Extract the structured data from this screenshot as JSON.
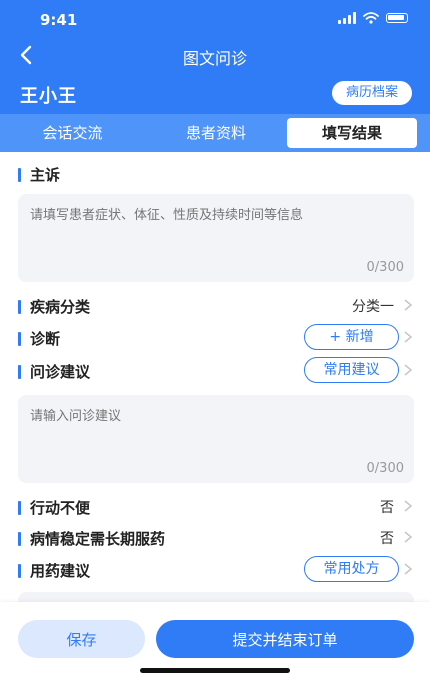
{
  "status": {
    "time": "9:41"
  },
  "nav": {
    "title": "图文问诊"
  },
  "patient": {
    "name": "王小王",
    "records_label": "病历档案"
  },
  "tabs": [
    {
      "label": "会话交流"
    },
    {
      "label": "患者资料"
    },
    {
      "label": "填写结果",
      "active": true
    }
  ],
  "form": {
    "complaint": {
      "title": "主诉",
      "placeholder": "请填写患者症状、体征、性质及持续时间等信息",
      "counter": "0/300"
    },
    "disease_category": {
      "title": "疾病分类",
      "value": "分类一"
    },
    "diagnosis": {
      "title": "诊断",
      "button": "+ 新增"
    },
    "advice": {
      "title": "问诊建议",
      "button": "常用建议",
      "placeholder": "请输入问诊建议",
      "counter": "0/300"
    },
    "mobility": {
      "title": "行动不便",
      "value": "否"
    },
    "long_term": {
      "title": "病情稳定需长期服药",
      "value": "否"
    },
    "medication": {
      "title": "用药建议",
      "button": "常用处方"
    }
  },
  "footer": {
    "save_label": "保存",
    "submit_label": "提交并结束订单"
  },
  "colors": {
    "primary": "#2f7cf6",
    "tab_bar": "#4f94f8",
    "field_bg": "#f3f4f7"
  }
}
